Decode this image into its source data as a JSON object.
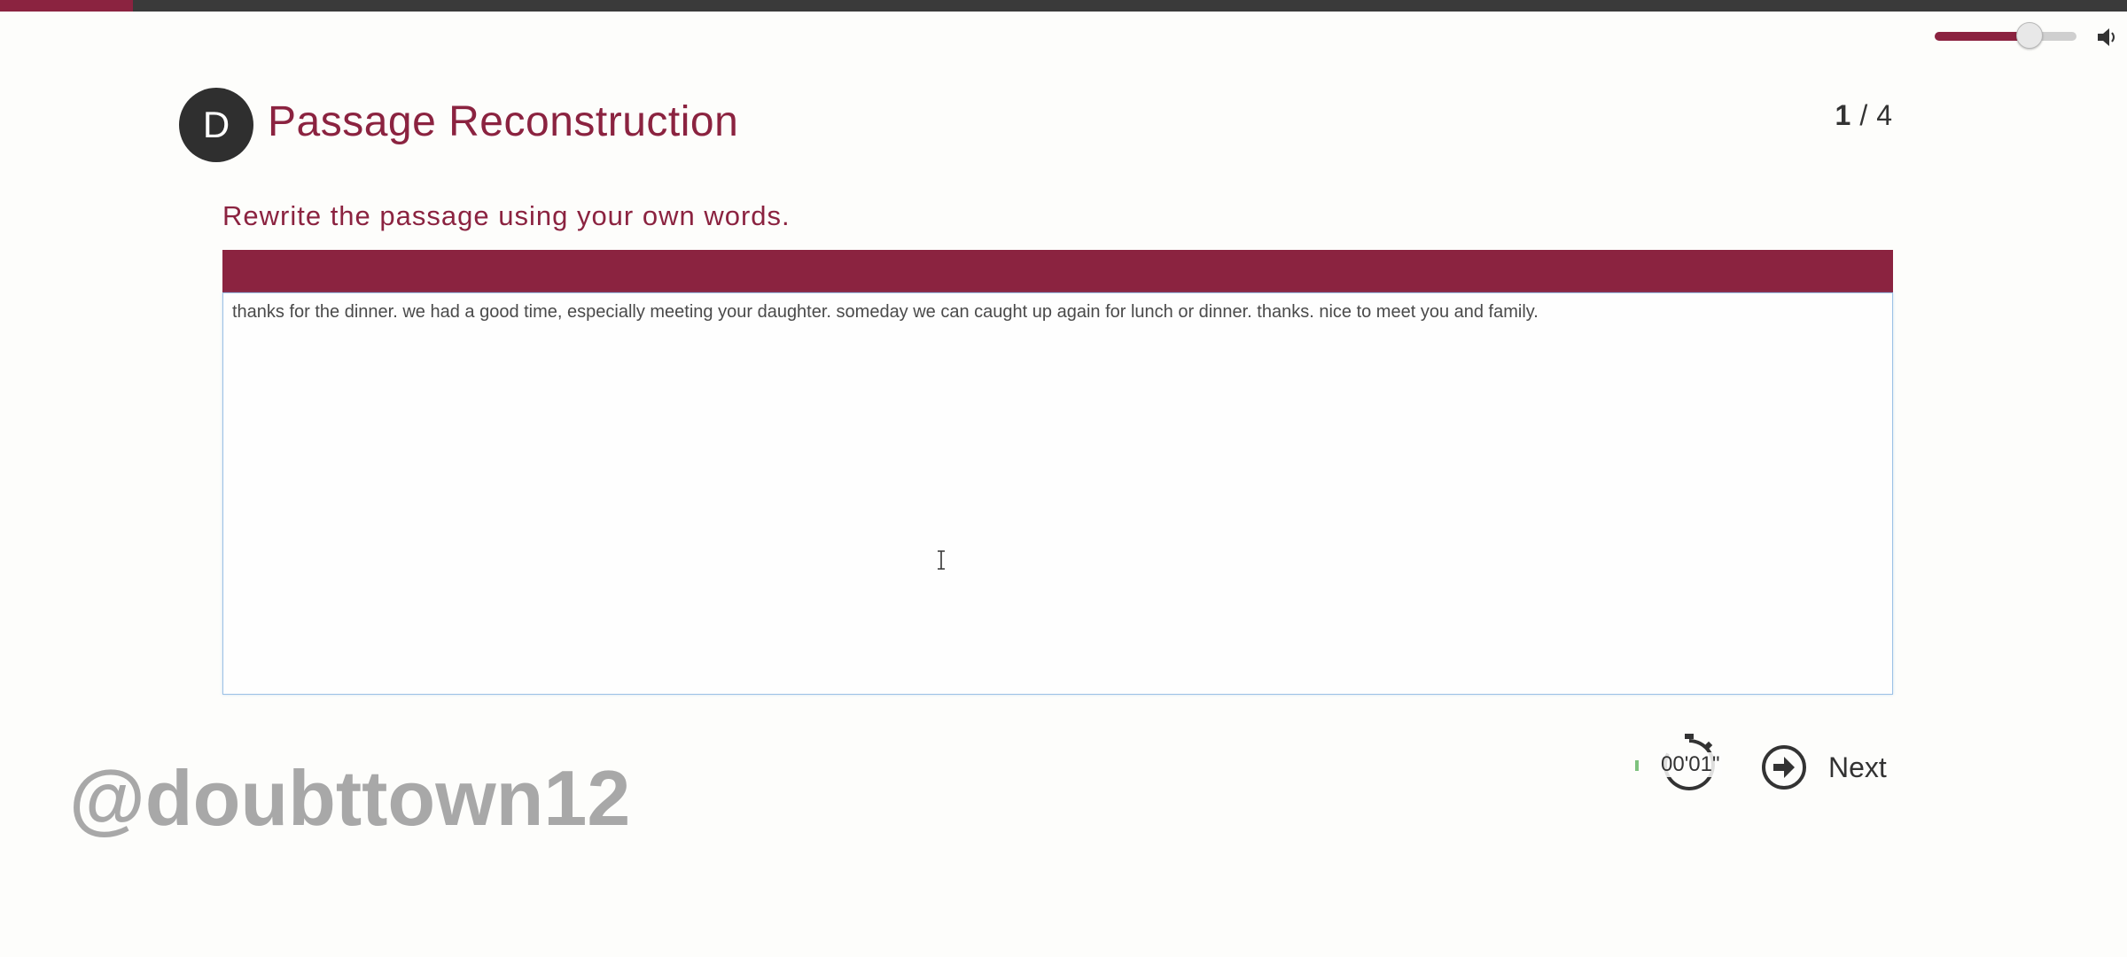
{
  "progress": {
    "fraction": 0.0625,
    "fill_color": "#8b2340"
  },
  "volume": {
    "level": 0.66,
    "icon": "speaker-icon"
  },
  "section": {
    "badge": "D",
    "title": "Passage Reconstruction",
    "page_current": "1",
    "page_separator": "/",
    "page_total": "4"
  },
  "instruction": "Rewrite the passage using your own words.",
  "answer": {
    "value": "thanks for the dinner. we had a good time, especially meeting your daughter. someday we can caught up again for lunch or dinner. thanks. nice to meet you and family."
  },
  "watermark": "@doubttown12",
  "timer": {
    "value": "00'01\"",
    "icon": "stopwatch-icon"
  },
  "next": {
    "label": "Next",
    "icon": "arrow-right-circle-icon"
  },
  "colors": {
    "accent": "#8b2340",
    "dark": "#2f2f2f",
    "input_border": "#9cc1e6"
  }
}
